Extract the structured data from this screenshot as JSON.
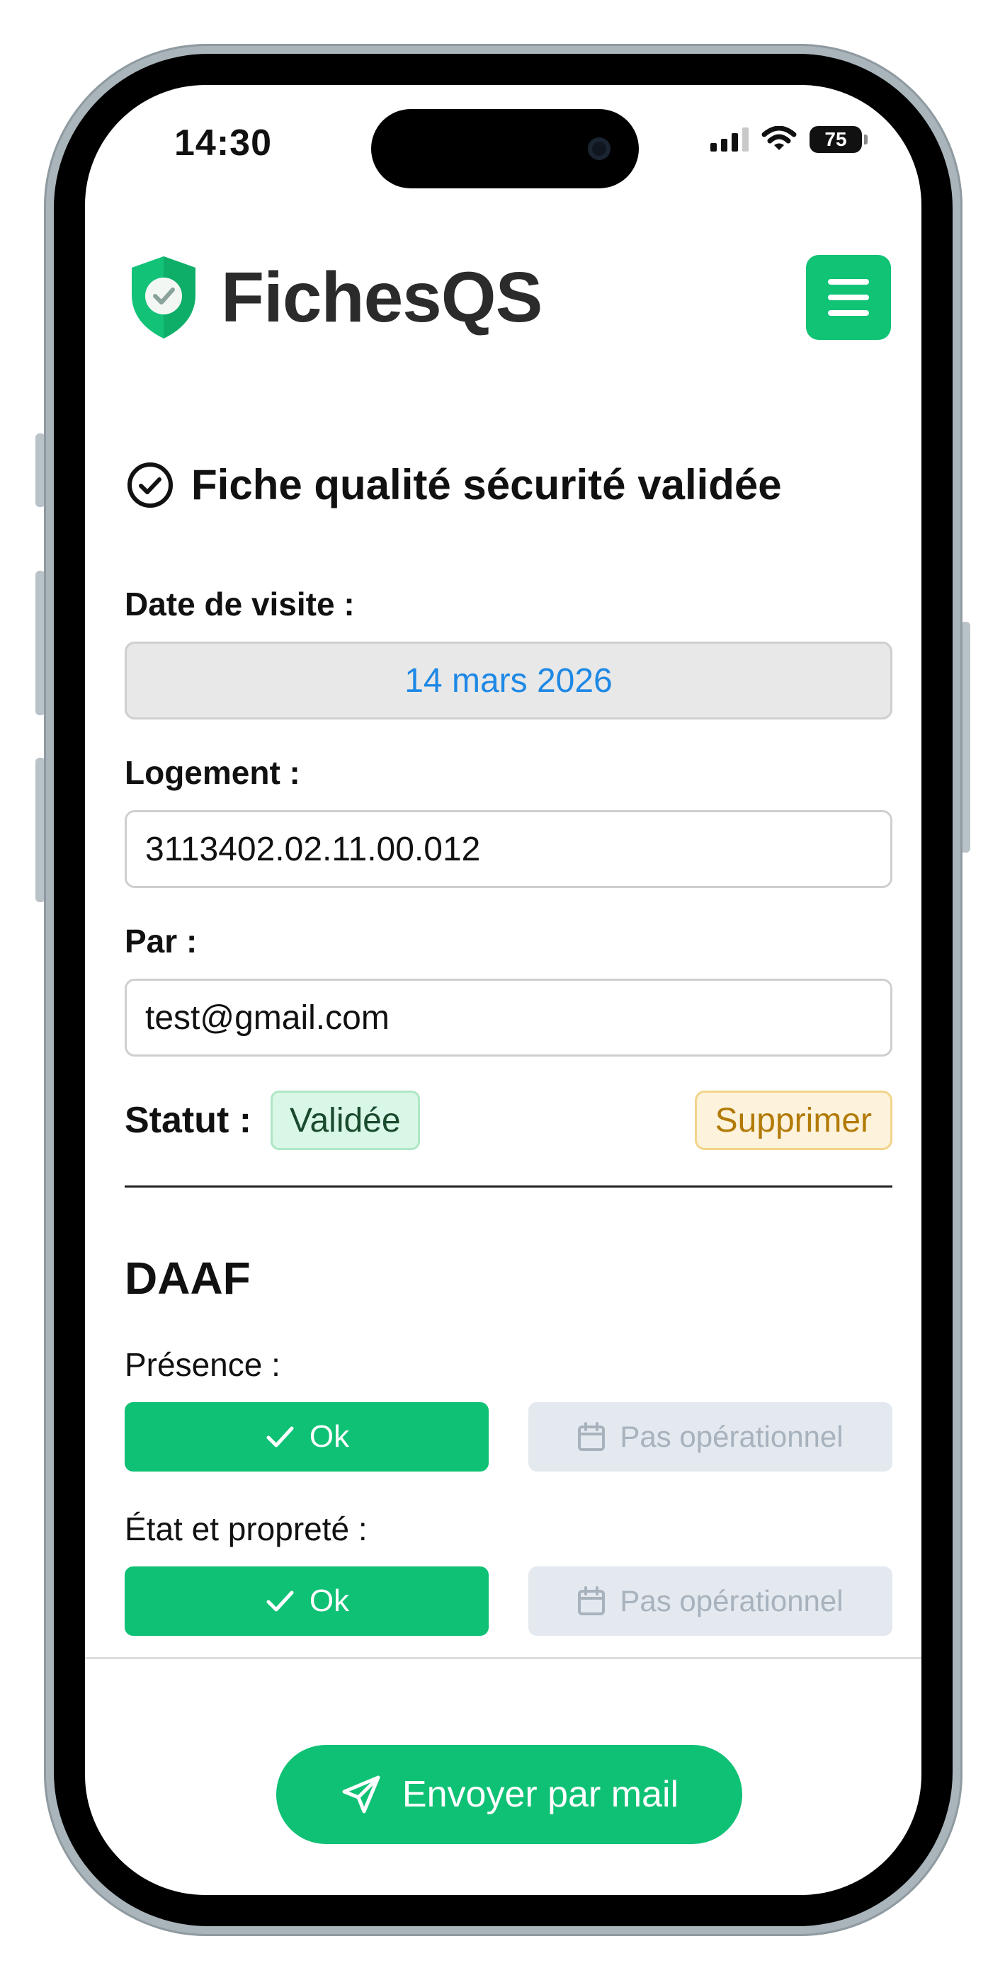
{
  "status_bar": {
    "time": "14:30",
    "battery": "75"
  },
  "app": {
    "title": "FichesQS",
    "accent": "#10c375"
  },
  "fiche": {
    "heading": "Fiche qualité sécurité validée",
    "date_label": "Date de visite :",
    "date_value": "14 mars 2026",
    "logement_label": "Logement :",
    "logement_value": "3113402.02.11.00.012",
    "par_label": "Par :",
    "par_value": "test@gmail.com",
    "statut_label": "Statut :",
    "statut_value": "Validée",
    "delete_label": "Supprimer"
  },
  "daaf": {
    "title": "DAAF",
    "presence_label": "Présence :",
    "etat_label": "État et propreté :",
    "ok_label": "Ok",
    "not_operational_label": "Pas opérationnel"
  },
  "footer": {
    "send_label": "Envoyer par mail"
  }
}
